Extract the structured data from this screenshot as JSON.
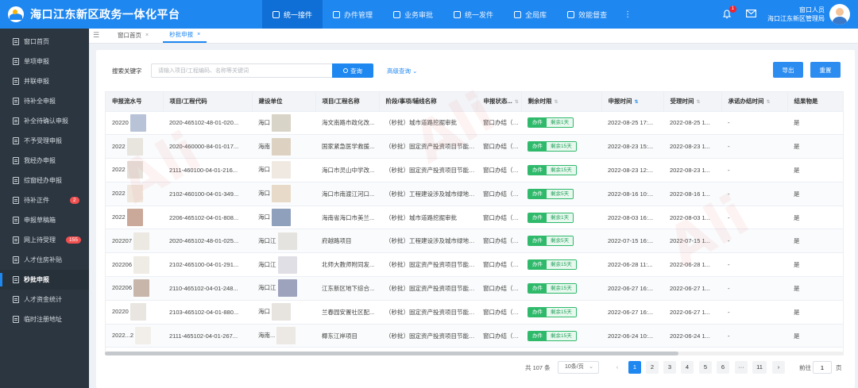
{
  "app": {
    "title": "海口江东新区政务一体化平台"
  },
  "nav": {
    "items": [
      {
        "label": "统一接件",
        "active": true
      },
      {
        "label": "办件管理",
        "active": false
      },
      {
        "label": "业务审批",
        "active": false
      },
      {
        "label": "统一发件",
        "active": false
      },
      {
        "label": "全局库",
        "active": false
      },
      {
        "label": "效能督查",
        "active": false
      }
    ],
    "more": "⋮"
  },
  "header": {
    "bell_count": "1",
    "user_name": "窗口人员",
    "user_org": "海口江东新区管理局"
  },
  "sidebar": {
    "items": [
      {
        "label": "窗口首页"
      },
      {
        "label": "单项申报"
      },
      {
        "label": "并联申报"
      },
      {
        "label": "待补全申报"
      },
      {
        "label": "补全待确认申报"
      },
      {
        "label": "不予受理申报"
      },
      {
        "label": "我经办申报"
      },
      {
        "label": "综窗经办申报"
      },
      {
        "label": "待补正件",
        "badge": "2"
      },
      {
        "label": "申报草稿箱"
      },
      {
        "label": "网上待受理",
        "badge": "155"
      },
      {
        "label": "人才住房补贴"
      },
      {
        "label": "秒批申报",
        "active": true
      },
      {
        "label": "人才资金统计"
      },
      {
        "label": "临时注册地址"
      }
    ]
  },
  "tabs": [
    {
      "label": "窗口首页",
      "close": "×"
    },
    {
      "label": "秒批申报",
      "close": "×",
      "active": true
    }
  ],
  "search": {
    "label": "搜索关键字",
    "placeholder": "请输入项目/工程编码、名称等关键词",
    "button": "查询",
    "advanced": "高级查询"
  },
  "actions": {
    "export": "导出",
    "reset": "重置"
  },
  "table": {
    "columns": [
      "申报流水号",
      "项目/工程代码",
      "建设单位",
      "项目/工程名称",
      "阶段/事项/辅线名称",
      "申报状态...",
      "剩余时限",
      "申报时间",
      "受理时间",
      "承诺办结时间",
      "结果物是"
    ],
    "rows": [
      {
        "serial": "20220",
        "code": "2020-465102-48-01-020...",
        "unit": "海口",
        "name": "海文南路市政化改...",
        "stage": "（秒批）城市道路挖掘审批",
        "status": "窗口办结（通...",
        "tag": "办件",
        "remain": "剩余1天",
        "apply_time": "2022-08-25 17:...",
        "accept_time": "2022-08-25 1...",
        "promise": "-",
        "result": "是"
      },
      {
        "serial": "2022",
        "code": "2020-460000-84-01-017...",
        "unit": "海南",
        "name": "国家紧急医学救援...",
        "stage": "（秒批）固定资产投资项目节能备案",
        "status": "窗口办结（通...",
        "tag": "办件",
        "remain": "剩余15天",
        "apply_time": "2022-08-23 15:...",
        "accept_time": "2022-08-23 1...",
        "promise": "-",
        "result": "是"
      },
      {
        "serial": "2022",
        "code": "2111-460100-04-01-216...",
        "unit": "海口",
        "name": "海口市灵山中学改...",
        "stage": "（秒批）固定资产投资项目节能备案",
        "status": "窗口办结（通...",
        "tag": "办件",
        "remain": "剩余15天",
        "apply_time": "2022-08-23 12:...",
        "accept_time": "2022-08-23 1...",
        "promise": "-",
        "result": "是"
      },
      {
        "serial": "2022",
        "code": "2102-460100-04-01-349...",
        "unit": "海口",
        "name": "海口市南渡江河口...",
        "stage": "（秒批）工程建设涉及城市绿地、树...",
        "status": "窗口办结（通...",
        "tag": "办件",
        "remain": "剩余5天",
        "apply_time": "2022-08-16 10:...",
        "accept_time": "2022-08-16 1...",
        "promise": "-",
        "result": "是"
      },
      {
        "serial": "2022",
        "code": "2206-465102-04-01-808...",
        "unit": "海口",
        "name": "海南省海口市美兰...",
        "stage": "（秒批）城市道路挖掘审批",
        "status": "窗口办结（通...",
        "tag": "办件",
        "remain": "剩余1天",
        "apply_time": "2022-08-03 16:...",
        "accept_time": "2022-08-03 1...",
        "promise": "-",
        "result": "是"
      },
      {
        "serial": "202207",
        "code": "2020-465102-48-01-025...",
        "unit": "海口江",
        "name": "府越路项目",
        "stage": "（秒批）工程建设涉及城市绿地、树...",
        "status": "窗口办结（通...",
        "tag": "办件",
        "remain": "剩余5天",
        "apply_time": "2022-07-15 16:...",
        "accept_time": "2022-07-15 1...",
        "promise": "-",
        "result": "是"
      },
      {
        "serial": "202206",
        "code": "2102-465100-04-01-291...",
        "unit": "海口江",
        "name": "北师大教师附同发...",
        "stage": "（秒批）固定资产投资项目节能备案",
        "status": "窗口办结（通...",
        "tag": "办件",
        "remain": "剩余15天",
        "apply_time": "2022-06-28 11:...",
        "accept_time": "2022-06-28 1...",
        "promise": "-",
        "result": "是"
      },
      {
        "serial": "202206",
        "code": "2110-465102-04-01-248...",
        "unit": "海口江",
        "name": "江东新区地下综合...",
        "stage": "（秒批）固定资产投资项目节能备案",
        "status": "窗口办结（通...",
        "tag": "办件",
        "remain": "剩余15天",
        "apply_time": "2022-06-27 16:...",
        "accept_time": "2022-06-27 1...",
        "promise": "-",
        "result": "是"
      },
      {
        "serial": "20220",
        "code": "2103-465102-04-01-880...",
        "unit": "海口",
        "name": "兰春园安置社区配...",
        "stage": "（秒批）固定资产投资项目节能备案",
        "status": "窗口办结（通...",
        "tag": "办件",
        "remain": "剩余15天",
        "apply_time": "2022-06-27 16:...",
        "accept_time": "2022-06-27 1...",
        "promise": "-",
        "result": "是"
      },
      {
        "serial": "2022...2",
        "code": "2111-465102-04-01-267...",
        "unit": "海南...",
        "name": "椰东江岸项目",
        "stage": "（秒批）固定资产投资项目节能备案",
        "status": "窗口办结（通...",
        "tag": "办件",
        "remain": "剩余15天",
        "apply_time": "2022-06-24 10:...",
        "accept_time": "2022-06-24 1...",
        "promise": "-",
        "result": "是"
      }
    ]
  },
  "pager": {
    "total": "共 107 条",
    "size": "10条/页",
    "pages": [
      "1",
      "2",
      "3",
      "4",
      "5",
      "6",
      "···",
      "11"
    ],
    "current": "1",
    "goto_label": "前往",
    "goto_value": "1",
    "page_suffix": "页"
  }
}
